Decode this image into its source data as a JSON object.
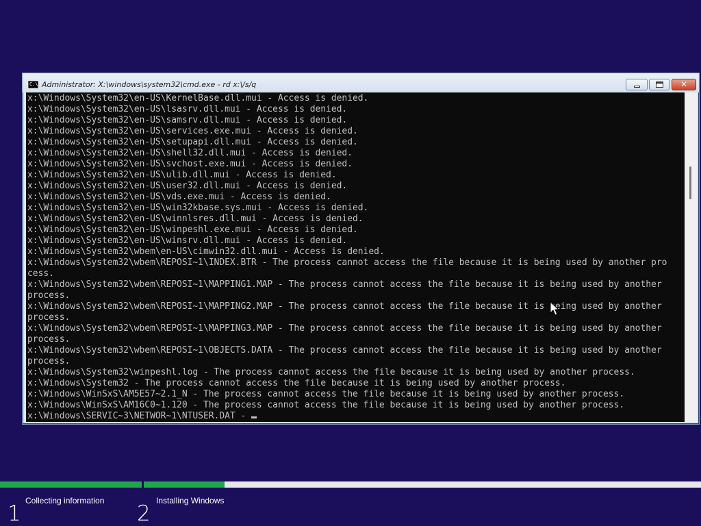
{
  "window": {
    "title": "Administrator: X:\\windows\\system32\\cmd.exe - rd  x:\\/s/q",
    "icon_text": "C:\\"
  },
  "console": {
    "lines": [
      "x:\\Windows\\System32\\en-US\\KernelBase.dll.mui - Access is denied.",
      "x:\\Windows\\System32\\en-US\\lsasrv.dll.mui - Access is denied.",
      "x:\\Windows\\System32\\en-US\\samsrv.dll.mui - Access is denied.",
      "x:\\Windows\\System32\\en-US\\services.exe.mui - Access is denied.",
      "x:\\Windows\\System32\\en-US\\setupapi.dll.mui - Access is denied.",
      "x:\\Windows\\System32\\en-US\\shell32.dll.mui - Access is denied.",
      "x:\\Windows\\System32\\en-US\\svchost.exe.mui - Access is denied.",
      "x:\\Windows\\System32\\en-US\\ulib.dll.mui - Access is denied.",
      "x:\\Windows\\System32\\en-US\\user32.dll.mui - Access is denied.",
      "x:\\Windows\\System32\\en-US\\vds.exe.mui - Access is denied.",
      "x:\\Windows\\System32\\en-US\\win32kbase.sys.mui - Access is denied.",
      "x:\\Windows\\System32\\en-US\\winnlsres.dll.mui - Access is denied.",
      "x:\\Windows\\System32\\en-US\\winpeshl.exe.mui - Access is denied.",
      "x:\\Windows\\System32\\en-US\\winsrv.dll.mui - Access is denied.",
      "x:\\Windows\\System32\\wbem\\en-US\\cimwin32.dll.mui - Access is denied.",
      "x:\\Windows\\System32\\wbem\\REPOSI~1\\INDEX.BTR - The process cannot access the file because it is being used by another pro",
      "cess.",
      "x:\\Windows\\System32\\wbem\\REPOSI~1\\MAPPING1.MAP - The process cannot access the file because it is being used by another",
      "process.",
      "x:\\Windows\\System32\\wbem\\REPOSI~1\\MAPPING2.MAP - The process cannot access the file because it is being used by another",
      "process.",
      "x:\\Windows\\System32\\wbem\\REPOSI~1\\MAPPING3.MAP - The process cannot access the file because it is being used by another",
      "process.",
      "x:\\Windows\\System32\\wbem\\REPOSI~1\\OBJECTS.DATA - The process cannot access the file because it is being used by another",
      "process.",
      "x:\\Windows\\System32\\winpeshl.log - The process cannot access the file because it is being used by another process.",
      "x:\\Windows\\System32 - The process cannot access the file because it is being used by another process.",
      "x:\\Windows\\WinSxS\\AM5E57~2.1_N - The process cannot access the file because it is being used by another process.",
      "x:\\Windows\\WinSxS\\AM16C0~1.120 - The process cannot access the file because it is being used by another process.",
      "x:\\Windows\\SERVIC~3\\NETWOR~1\\NTUSER.DAT - "
    ]
  },
  "setup": {
    "progress_fraction": 0.32,
    "steps": [
      {
        "number": "1",
        "label": "Collecting information"
      },
      {
        "number": "2",
        "label": "Installing Windows"
      }
    ]
  },
  "colors": {
    "desktop_background": "#1b0e5a",
    "progress_fill": "#1ea84a",
    "console_text": "#c0c0c0"
  },
  "icons": [
    "cmd-icon",
    "minimize-icon",
    "maximize-icon",
    "close-icon",
    "mouse-pointer-icon"
  ]
}
